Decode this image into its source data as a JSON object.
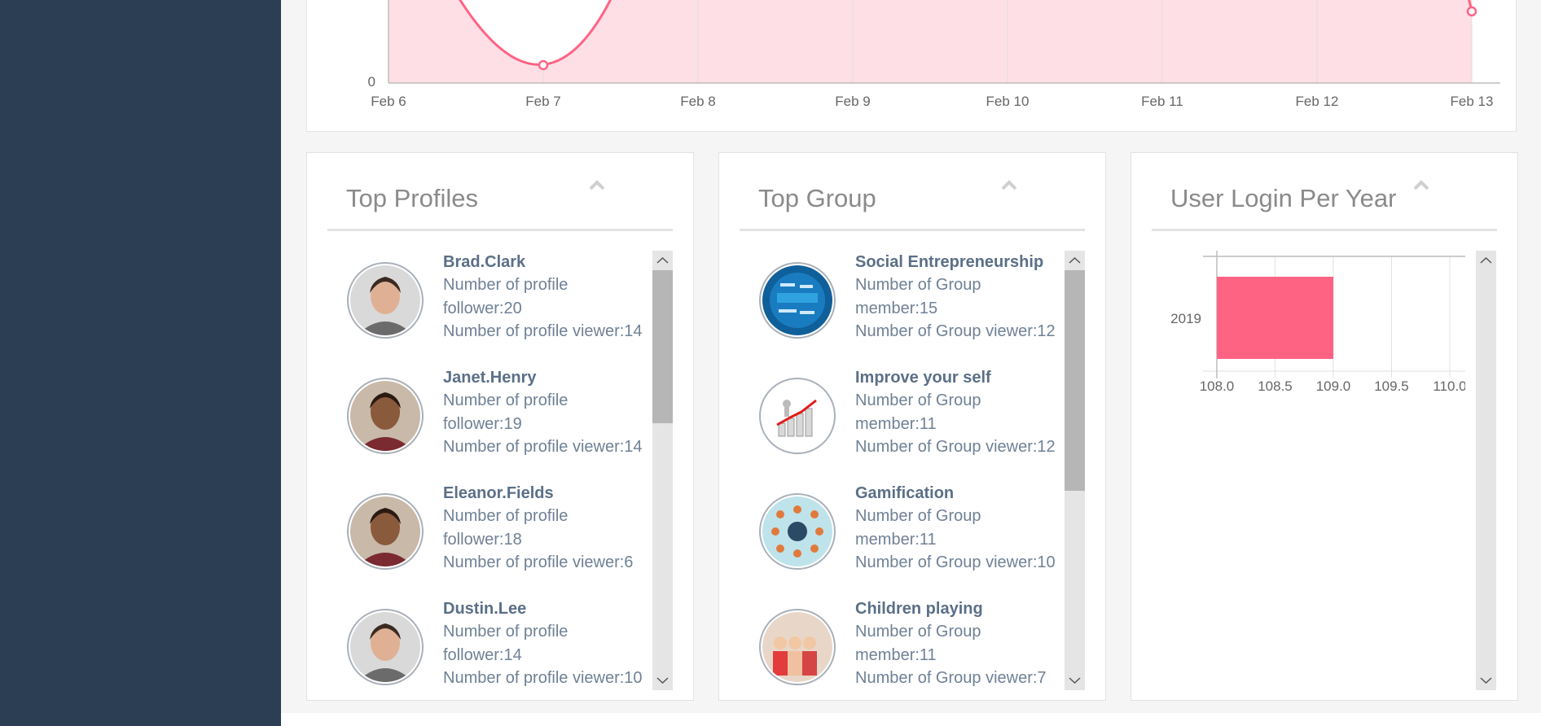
{
  "colors": {
    "sidebar": "#2c3e54",
    "accent": "#ff6384",
    "accent_fill": "#ffdfe6",
    "text_name": "#5b6f87",
    "text_body": "#6f8196"
  },
  "line_chart": {
    "chart_data": {
      "type": "area",
      "x": [
        "Feb 6",
        "Feb 7",
        "Feb 8",
        "Feb 9",
        "Feb 10",
        "Feb 11",
        "Feb 12",
        "Feb 13"
      ],
      "y_tick_labels": [
        "0"
      ],
      "series": [
        {
          "values_visible_points": [
            {
              "x": "Feb 7",
              "y_level": "low"
            },
            {
              "x": "Feb 13",
              "y_level": "mid"
            }
          ]
        }
      ],
      "grid": true
    }
  },
  "top_profiles": {
    "title": "Top Profiles",
    "items": [
      {
        "name": "Brad.Clark",
        "line1": "Number of profile",
        "line2": "follower:20",
        "line3": "Number of profile viewer:14",
        "avatar_icon": "man-portrait"
      },
      {
        "name": "Janet.Henry",
        "line1": "Number of profile",
        "line2": "follower:19",
        "line3": "Number of profile viewer:14",
        "avatar_icon": "woman-portrait"
      },
      {
        "name": "Eleanor.Fields",
        "line1": "Number of profile",
        "line2": "follower:18",
        "line3": "Number of profile viewer:6",
        "avatar_icon": "woman-portrait"
      },
      {
        "name": "Dustin.Lee",
        "line1": "Number of profile",
        "line2": "follower:14",
        "line3": "Number of profile viewer:10",
        "avatar_icon": "man-portrait"
      }
    ]
  },
  "top_group": {
    "title": "Top Group",
    "items": [
      {
        "name": "Social Entrepreneurship",
        "line1": "Number of Group",
        "line2": "member:15",
        "line3": "Number of Group viewer:12",
        "avatar_icon": "entrepreneur-wordcloud"
      },
      {
        "name": "Improve your self",
        "line1": "Number of Group",
        "line2": "member:11",
        "line3": "Number of Group viewer:12",
        "avatar_icon": "growth-chart"
      },
      {
        "name": "Gamification",
        "line1": "Number of Group",
        "line2": "member:11",
        "line3": "Number of Group viewer:10",
        "avatar_icon": "gamification-icons"
      },
      {
        "name": "Children playing",
        "line1": "Number of Group",
        "line2": "member:11",
        "line3": "Number of Group viewer:7",
        "avatar_icon": "children-photo"
      }
    ]
  },
  "user_login": {
    "title": "User Login Per Year",
    "chart_data": {
      "type": "bar",
      "orientation": "horizontal",
      "categories": [
        "2019"
      ],
      "values": [
        109.0
      ],
      "xlim": [
        108.0,
        110.0
      ],
      "x_tick_labels": [
        "108.0",
        "108.5",
        "109.0",
        "109.5",
        "110.0"
      ],
      "grid": true
    }
  }
}
